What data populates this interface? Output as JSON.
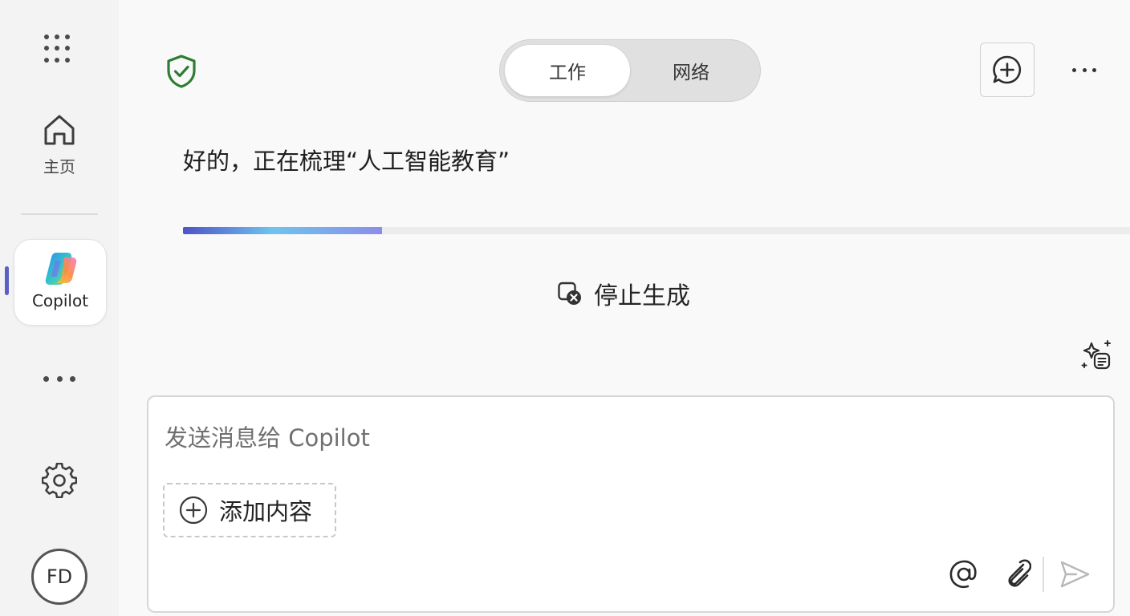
{
  "rail": {
    "home_label": "主页",
    "copilot_label": "Copilot",
    "avatar_initials": "FD"
  },
  "header": {
    "mode_toggle": {
      "options": [
        "工作",
        "网络"
      ],
      "selected": "工作"
    }
  },
  "conversation": {
    "status_text": "好的，正在梳理“人工智能教育”",
    "progress_fraction": 0.21,
    "stop_label": "停止生成"
  },
  "composer": {
    "placeholder": "发送消息给 Copilot",
    "value": "",
    "add_content_label": "添加内容"
  },
  "icons": {
    "rail": [
      "app-launcher-icon",
      "home-icon",
      "copilot-logo-icon",
      "more-icon",
      "settings-icon"
    ],
    "header": [
      "shield-check-icon",
      "new-chat-icon",
      "more-options-icon"
    ],
    "content": [
      "stop-icon",
      "prompt-gallery-icon"
    ],
    "composer": [
      "add-circle-icon",
      "mention-icon",
      "attach-icon",
      "send-icon"
    ]
  },
  "colors": {
    "accent": "#5b5fc7",
    "shield": "#2e7d32",
    "progress_start": "#4f52c8",
    "progress_mid": "#6fc3ee",
    "progress_end": "#8b8ee8"
  }
}
